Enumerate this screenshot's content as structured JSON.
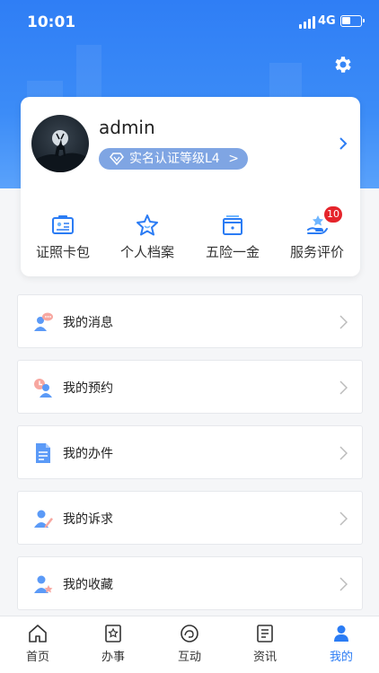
{
  "status_bar": {
    "time": "10:01",
    "network": "4G"
  },
  "profile": {
    "username": "admin",
    "certification": "实名认证等级L4",
    "certification_chevron": ">"
  },
  "shortcuts": [
    {
      "label": "证照卡包",
      "icon": "id-card-icon"
    },
    {
      "label": "个人档案",
      "icon": "star-profile-icon"
    },
    {
      "label": "五险一金",
      "icon": "insurance-icon"
    },
    {
      "label": "服务评价",
      "icon": "rating-hand-icon",
      "badge": "10"
    }
  ],
  "menu": [
    {
      "label": "我的消息",
      "icon": "message-user-icon"
    },
    {
      "label": "我的预约",
      "icon": "appointment-icon"
    },
    {
      "label": "我的办件",
      "icon": "document-icon"
    },
    {
      "label": "我的诉求",
      "icon": "appeal-user-icon"
    },
    {
      "label": "我的收藏",
      "icon": "favorite-user-icon"
    }
  ],
  "tabbar": [
    {
      "label": "首页",
      "icon": "home-icon"
    },
    {
      "label": "办事",
      "icon": "service-icon"
    },
    {
      "label": "互动",
      "icon": "interaction-icon"
    },
    {
      "label": "资讯",
      "icon": "news-icon"
    },
    {
      "label": "我的",
      "icon": "user-icon",
      "active": true
    }
  ],
  "colors": {
    "primary": "#2b7cf4",
    "header_blue": "#3c8cf7",
    "badge_red": "#e5242b",
    "cert_badge": "#7fa5e3"
  }
}
